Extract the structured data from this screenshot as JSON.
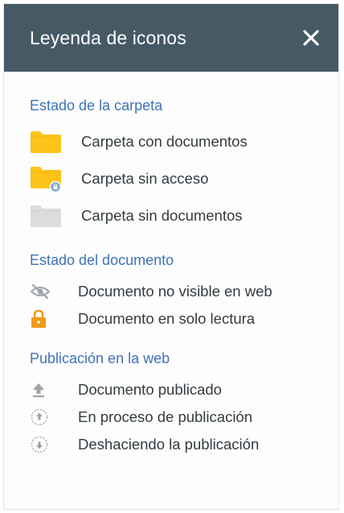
{
  "header": {
    "title": "Leyenda de iconos",
    "close_icon": "close-icon"
  },
  "sections": [
    {
      "title": "Estado de la carpeta",
      "items": [
        {
          "label": "Carpeta con documentos",
          "icon": "folder-yellow-icon"
        },
        {
          "label": "Carpeta sin acceso",
          "icon": "folder-locked-icon"
        },
        {
          "label": "Carpeta sin documentos",
          "icon": "folder-empty-icon"
        }
      ]
    },
    {
      "title": "Estado del documento",
      "items": [
        {
          "label": "Documento no visible en web",
          "icon": "eye-off-icon"
        },
        {
          "label": "Documento en solo lectura",
          "icon": "lock-icon"
        }
      ]
    },
    {
      "title": "Publicación en la web",
      "items": [
        {
          "label": "Documento publicado",
          "icon": "upload-icon"
        },
        {
          "label": "En proceso de publicación",
          "icon": "upload-circle-icon"
        },
        {
          "label": "Deshaciendo la publicación",
          "icon": "download-circle-icon"
        }
      ]
    }
  ],
  "colors": {
    "header_bg": "#465a66",
    "section_title": "#3f73b6",
    "folder_yellow": "#fcc419",
    "folder_grey": "#dcdcdc",
    "lock_orange": "#f09b1b",
    "icon_grey": "#9ea3a6"
  }
}
